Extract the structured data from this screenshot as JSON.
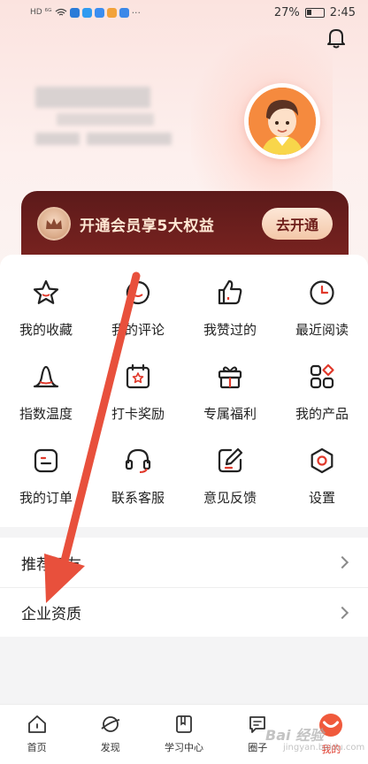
{
  "status_bar": {
    "left_indicators": "HD ⁶ᴳ",
    "battery": "27%",
    "time": "2:45"
  },
  "vip": {
    "text": "开通会员享5大权益",
    "button": "去开通"
  },
  "grid": [
    {
      "label": "我的收藏",
      "icon": "star-icon"
    },
    {
      "label": "我的评论",
      "icon": "comment-icon"
    },
    {
      "label": "我赞过的",
      "icon": "thumbs-up-icon"
    },
    {
      "label": "最近阅读",
      "icon": "clock-icon"
    },
    {
      "label": "指数温度",
      "icon": "bell-curve-icon"
    },
    {
      "label": "打卡奖励",
      "icon": "calendar-star-icon"
    },
    {
      "label": "专属福利",
      "icon": "gift-box-icon"
    },
    {
      "label": "我的产品",
      "icon": "apps-icon"
    },
    {
      "label": "我的订单",
      "icon": "order-icon"
    },
    {
      "label": "联系客服",
      "icon": "headset-icon"
    },
    {
      "label": "意见反馈",
      "icon": "edit-icon"
    },
    {
      "label": "设置",
      "icon": "settings-hex-icon"
    }
  ],
  "list": [
    {
      "label": "推荐好友"
    },
    {
      "label": "企业资质"
    }
  ],
  "tabs": [
    {
      "label": "首页",
      "icon": "home-icon"
    },
    {
      "label": "发现",
      "icon": "planet-icon"
    },
    {
      "label": "学习中心",
      "icon": "study-icon"
    },
    {
      "label": "圈子",
      "icon": "chat-icon"
    },
    {
      "label": "我的",
      "icon": "me-icon",
      "active": true
    }
  ],
  "watermark": {
    "text": "Bai 经验",
    "sub": "jingyan.baidu.com"
  },
  "colors": {
    "accent": "#e0392b",
    "vip_bg": "#6b1f1c",
    "arrow": "#e8503c"
  }
}
